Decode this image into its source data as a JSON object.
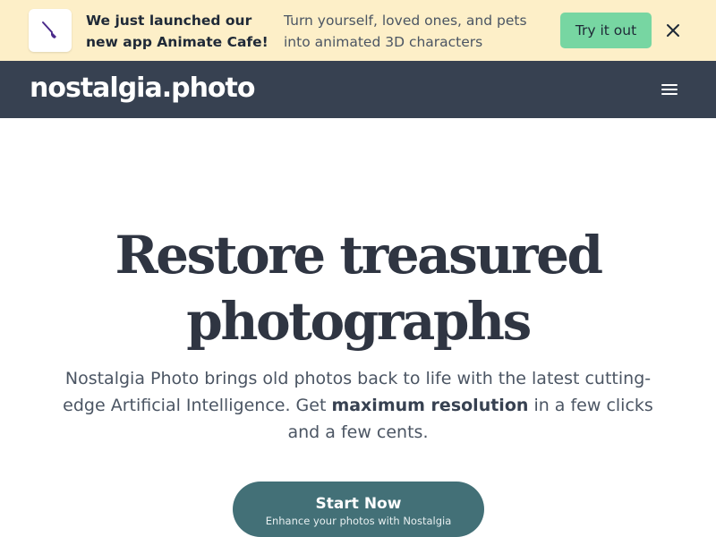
{
  "banner": {
    "headline": "We just launched our new app Animate Cafe!",
    "description": "Turn yourself, loved ones, and pets into animated 3D characters",
    "cta_label": "Try it out",
    "logo_icon": "paintbrush-icon",
    "close_icon": "close-icon",
    "background_color": "#fdefc8",
    "cta_color": "#77d6a2"
  },
  "navbar": {
    "brand": "nostalgia.photo",
    "menu_icon": "hamburger-menu-icon",
    "background_color": "#374151"
  },
  "hero": {
    "title": "Restore treasured photographs",
    "subtitle_before": "Nostalgia Photo brings old photos back to life with the latest cutting-edge Artificial Intelligence. Get ",
    "subtitle_bold": "maximum resolution",
    "subtitle_after": " in a few clicks and a few cents.",
    "cta_title": "Start Now",
    "cta_subtitle": "Enhance your photos with Nostalgia",
    "cta_color": "#437077"
  }
}
